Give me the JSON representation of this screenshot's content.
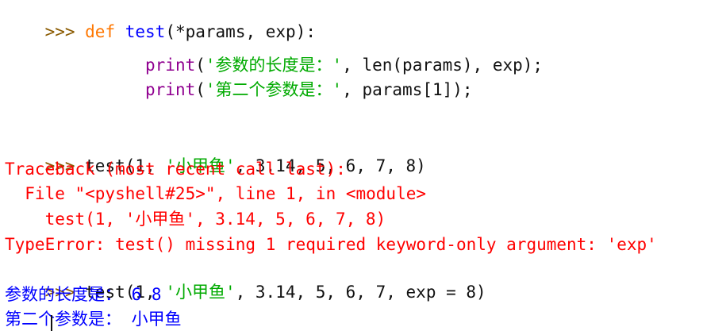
{
  "shell": {
    "prompt": ">>> ",
    "def_block": {
      "kw": "def",
      "fn_name": "test",
      "signature": "(*params, exp):",
      "indent": "      ",
      "line2_builtin": "print",
      "line2_open": "(",
      "line2_string": "'参数的长度是：'",
      "line2_rest": ", len(params), exp);",
      "line3_builtin": "print",
      "line3_open": "(",
      "line3_string": "'第二个参数是：'",
      "line3_rest": ", params[1]);"
    },
    "call1": {
      "pre": "test(1, ",
      "string": "'小甲鱼'",
      "post": ", 3.14, 5, 6, 7, 8)"
    },
    "traceback": {
      "header": "Traceback (most recent call last):",
      "file_line": "  File \"<pyshell#25>\", line 1, in <module>",
      "code_line": "    test(1, '小甲鱼', 3.14, 5, 6, 7, 8)",
      "error": "TypeError: test() missing 1 required keyword-only argument: 'exp'"
    },
    "call2": {
      "pre": "test(1, ",
      "string": "'小甲鱼'",
      "post": ", 3.14, 5, 6, 7, exp = 8)"
    },
    "output": {
      "line1": "参数的长度是： 6 8",
      "line2": "第二个参数是： 小甲鱼"
    }
  }
}
